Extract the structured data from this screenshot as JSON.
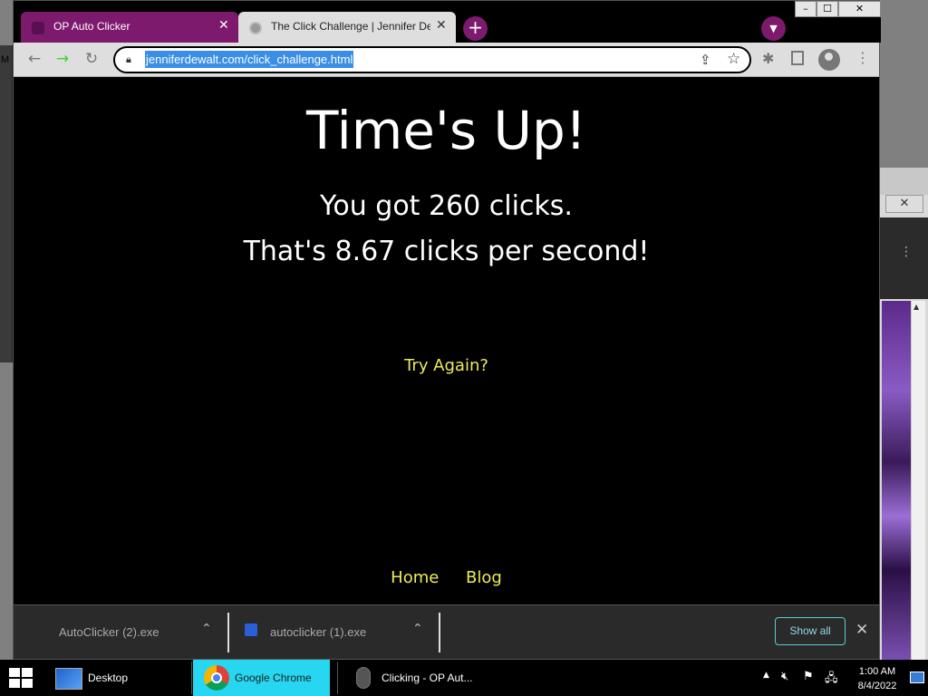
{
  "tabs": [
    {
      "title": "OP Auto Clicker",
      "active": false
    },
    {
      "title": "The Click Challenge | Jennifer De",
      "active": true
    }
  ],
  "window_controls": {
    "minimize": "–",
    "maximize": "☐",
    "close": "✕"
  },
  "address_bar": {
    "url": "jenniferdewalt.com/click_challenge.html"
  },
  "page": {
    "heading": "Time's Up!",
    "clicks_text": "You got 260 clicks.",
    "cps_text": "That's 8.67 clicks per second!",
    "try_again": "Try Again?",
    "footer_links": [
      "Home",
      "Blog"
    ]
  },
  "downloads": {
    "items": [
      {
        "name": "AutoClicker (2).exe"
      },
      {
        "name": "autoclicker (1).exe"
      }
    ],
    "show_all_label": "Show all"
  },
  "background": {
    "left_window_letter": "M"
  },
  "taskbar": {
    "items": [
      {
        "label": "Desktop"
      },
      {
        "label": "Google Chrome"
      },
      {
        "label": "Clicking - OP Aut..."
      }
    ],
    "clock_time": "1:00 AM",
    "clock_date": "8/4/2022"
  },
  "colors": {
    "tab_accent": "#7d1a6e",
    "link_color": "#ecec5a",
    "url_highlight": "#3a8ee6",
    "show_all_border": "#5fc8d6",
    "chrome_task_highlight": "#27d6f0"
  }
}
